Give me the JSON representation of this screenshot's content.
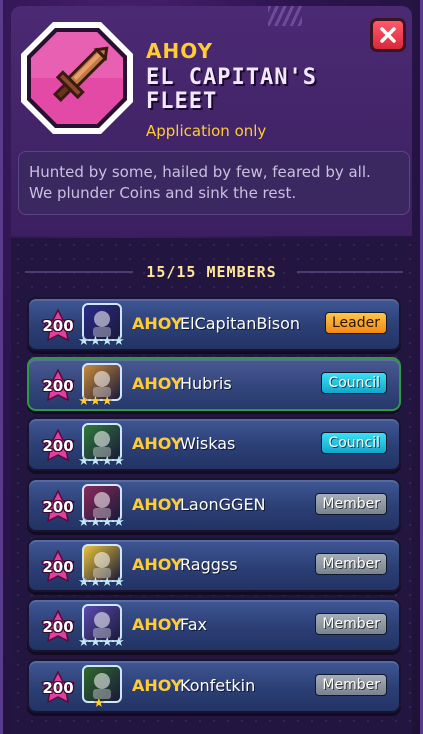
{
  "clan": {
    "tag": "AHOY",
    "name_line1": "EL CAPITAN'S",
    "name_line2": "FLEET",
    "join_type": "Application only",
    "description_line1": "Hunted by some, hailed by few, feared by all.",
    "description_line2": "We plunder Coins and sink the rest."
  },
  "members_header": "15/15 MEMBERS",
  "members": [
    {
      "level": "200",
      "tag": "AHOY",
      "name": "ElCapitanBison",
      "role": "Leader",
      "role_type": "leader",
      "stars": 4,
      "star_color": "#bfe8ff",
      "avatar_color": "#2a2a8a",
      "avatar_icon": "dark-knight-icon"
    },
    {
      "level": "200",
      "tag": "AHOY",
      "name": "Hubris",
      "role": "Council",
      "role_type": "council",
      "stars": 3,
      "star_color": "#ffcf3a",
      "avatar_color": "#c98a3a",
      "avatar_icon": "warrior-icon"
    },
    {
      "level": "200",
      "tag": "AHOY",
      "name": "Wiskas",
      "role": "Council",
      "role_type": "council",
      "stars": 4,
      "star_color": "#bfe8ff",
      "avatar_color": "#2f7a3a",
      "avatar_icon": "dragon-icon"
    },
    {
      "level": "200",
      "tag": "AHOY",
      "name": "LaonGGEN",
      "role": "Member",
      "role_type": "member",
      "stars": 4,
      "star_color": "#bfe8ff",
      "avatar_color": "#8a2a5a",
      "avatar_icon": "demon-icon"
    },
    {
      "level": "200",
      "tag": "AHOY",
      "name": "Raggss",
      "role": "Member",
      "role_type": "member",
      "stars": 4,
      "star_color": "#bfe8ff",
      "avatar_color": "#e8c23a",
      "avatar_icon": "pet-icon"
    },
    {
      "level": "200",
      "tag": "AHOY",
      "name": "Fax",
      "role": "Member",
      "role_type": "member",
      "stars": 4,
      "star_color": "#bfe8ff",
      "avatar_color": "#5a4ab0",
      "avatar_icon": "unicorn-icon"
    },
    {
      "level": "200",
      "tag": "AHOY",
      "name": "Konfetkin",
      "role": "Member",
      "role_type": "member",
      "stars": 1,
      "star_color": "#ffcf3a",
      "avatar_color": "#2f6a2a",
      "avatar_icon": "goblin-icon"
    }
  ],
  "colors": {
    "accent_gold": "#ffcc33",
    "leader": "#f5a623",
    "council": "#20c3e0",
    "member": "#8e97a2",
    "close": "#e83a4a",
    "level_badge": "#e040a0"
  }
}
